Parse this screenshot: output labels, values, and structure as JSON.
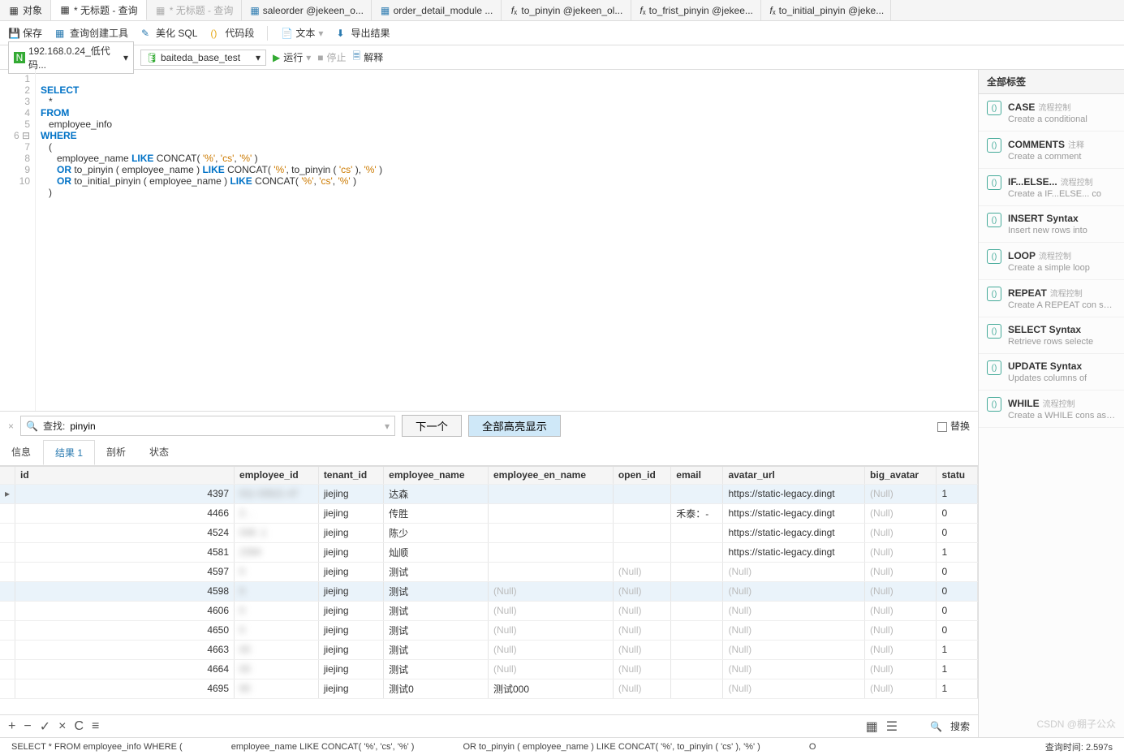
{
  "tabs": {
    "objects": "对象",
    "untitled_active": "* 无标题 - 查询",
    "untitled_gray": "* 无标题 - 查询",
    "saleorder": "saleorder @jekeen_o...",
    "order_detail": "order_detail_module ...",
    "to_pinyin": "to_pinyin @jekeen_ol...",
    "to_first_pinyin": "to_frist_pinyin @jekee...",
    "to_initial_pinyin": "to_initial_pinyin @jeke..."
  },
  "toolbar": {
    "save": "保存",
    "query_builder": "查询创建工具",
    "beautify": "美化 SQL",
    "code_block": "代码段",
    "text": "文本",
    "export": "导出结果"
  },
  "connection": {
    "host": "192.168.0.24_低代码...",
    "db": "baiteda_base_test",
    "run": "运行",
    "stop": "停止",
    "explain": "解释"
  },
  "code": {
    "l1a": "SELECT",
    "l2": "   *",
    "l3": "FROM",
    "l4": "   employee_info",
    "l5": "WHERE",
    "l6": "   (",
    "l7_a": "      employee_name ",
    "l7_b": "LIKE",
    "l7_c": " CONCAT( ",
    "l7_s1": "'%'",
    "l7_cm1": ", ",
    "l7_s2": "'cs'",
    "l7_cm2": ", ",
    "l7_s3": "'%'",
    "l7_d": " )",
    "l8_a": "      ",
    "l8_or": "OR",
    "l8_b": " to_pinyin ( employee_name ) ",
    "l8_like": "LIKE",
    "l8_c": " CONCAT( ",
    "l8_s1": "'%'",
    "l8_cm1": ", to_pinyin ( ",
    "l8_s2": "'cs'",
    "l8_cm2": " ), ",
    "l8_s3": "'%'",
    "l8_d": " )",
    "l9_a": "      ",
    "l9_or": "OR",
    "l9_b": " to_initial_pinyin ( employee_name ) ",
    "l9_like": "LIKE",
    "l9_c": " CONCAT( ",
    "l9_s1": "'%'",
    "l9_cm1": ", ",
    "l9_s2": "'cs'",
    "l9_cm2": ", ",
    "l9_s3": "'%'",
    "l9_d": " )",
    "l10": "   )"
  },
  "search": {
    "placeholder": "查找:",
    "value": "pinyin",
    "next": "下一个",
    "highlight_all": "全部高亮显示",
    "replace": "替换"
  },
  "result_tabs": {
    "info": "信息",
    "result1": "结果 1",
    "parse": "剖析",
    "status": "状态"
  },
  "columns": [
    "",
    "id",
    "employee_id",
    "tenant_id",
    "employee_name",
    "employee_en_name",
    "open_id",
    "email",
    "avatar_url",
    "big_avatar",
    "statu"
  ],
  "rows": [
    {
      "ptr": "▸",
      "id": "4397",
      "emp": "011          03521     47",
      "tenant": "jiejing",
      "name": "达森",
      "en": "",
      "open": "",
      "email": "",
      "avatar": "https://static-legacy.dingt",
      "big": "(Null)",
      "status": "1"
    },
    {
      "ptr": "",
      "id": "4466",
      "emp": "      2.       .",
      "tenant": "jiejing",
      "name": "传胜",
      "en": "",
      "open": "",
      "email": "禾泰：-",
      "avatar": "https://static-legacy.dingt",
      "big": "(Null)",
      "status": "0"
    },
    {
      "ptr": "",
      "id": "4524",
      "emp": "      049     .1",
      "tenant": "jiejing",
      "name": "陈少",
      "en": "",
      "open": "",
      "email": "",
      "avatar": "https://static-legacy.dingt",
      "big": "(Null)",
      "status": "0"
    },
    {
      "ptr": "",
      "id": "4581",
      "emp": "              2394",
      "tenant": "jiejing",
      "name": "灿顺",
      "en": "",
      "open": "",
      "email": "",
      "avatar": "https://static-legacy.dingt",
      "big": "(Null)",
      "status": "1"
    },
    {
      "ptr": "",
      "id": "4597",
      "emp": "0",
      "tenant": "jiejing",
      "name": "测试",
      "en": "",
      "open": "(Null)",
      "email": "",
      "avatar": "(Null)",
      "big": "(Null)",
      "status": "0"
    },
    {
      "ptr": "",
      "id": "4598",
      "emp": "0",
      "tenant": "jiejing",
      "name": "测试",
      "en": "(Null)",
      "open": "(Null)",
      "email": "",
      "avatar": "(Null)",
      "big": "(Null)",
      "status": "0"
    },
    {
      "ptr": "",
      "id": "4606",
      "emp": "0",
      "tenant": "jiejing",
      "name": "测试",
      "en": "(Null)",
      "open": "(Null)",
      "email": "",
      "avatar": "(Null)",
      "big": "(Null)",
      "status": "0"
    },
    {
      "ptr": "",
      "id": "4650",
      "emp": "0",
      "tenant": "jiejing",
      "name": "测试",
      "en": "(Null)",
      "open": "(Null)",
      "email": "",
      "avatar": "(Null)",
      "big": "(Null)",
      "status": "0"
    },
    {
      "ptr": "",
      "id": "4663",
      "emp": "00",
      "tenant": "jiejing",
      "name": "测试",
      "en": "(Null)",
      "open": "(Null)",
      "email": "",
      "avatar": "(Null)",
      "big": "(Null)",
      "status": "1"
    },
    {
      "ptr": "",
      "id": "4664",
      "emp": "00",
      "tenant": "jiejing",
      "name": "测试",
      "en": "(Null)",
      "open": "(Null)",
      "email": "",
      "avatar": "(Null)",
      "big": "(Null)",
      "status": "1"
    },
    {
      "ptr": "",
      "id": "4695",
      "emp": "90",
      "tenant": "jiejing",
      "name": "测试0",
      "en": "测试000",
      "open": "(Null)",
      "email": "",
      "avatar": "(Null)",
      "big": "(Null)",
      "status": "1"
    }
  ],
  "right_panel": {
    "title": "全部标签",
    "items": [
      {
        "title": "CASE",
        "sub": "流程控制",
        "desc": "Create a conditional"
      },
      {
        "title": "COMMENTS",
        "sub": "注释",
        "desc": "Create a comment"
      },
      {
        "title": "IF...ELSE...",
        "sub": "流程控制",
        "desc": "Create a IF...ELSE... co"
      },
      {
        "title": "INSERT Syntax",
        "sub": "",
        "desc": "Insert new rows into"
      },
      {
        "title": "LOOP",
        "sub": "流程控制",
        "desc": "Create a simple loop"
      },
      {
        "title": "REPEAT",
        "sub": "流程控制",
        "desc": "Create A REPEAT con search_condition exp"
      },
      {
        "title": "SELECT Syntax",
        "sub": "",
        "desc": "Retrieve rows selecte"
      },
      {
        "title": "UPDATE Syntax",
        "sub": "",
        "desc": "Updates columns of"
      },
      {
        "title": "WHILE",
        "sub": "流程控制",
        "desc": "Create a WHILE cons as long as the search"
      }
    ]
  },
  "footer": {
    "l1": "SELECT  *  FROM  employee_info  WHERE        (",
    "l2": "employee_name LIKE CONCAT( '%', 'cs', '%' )",
    "l3": "OR to_pinyin ( employee_name ) LIKE CONCAT( '%', to_pinyin ( 'cs' ), '%' )",
    "l4": "O",
    "time": "查询时间: 2.597s",
    "search": "搜索"
  },
  "watermark": "CSDN @棚子公众"
}
